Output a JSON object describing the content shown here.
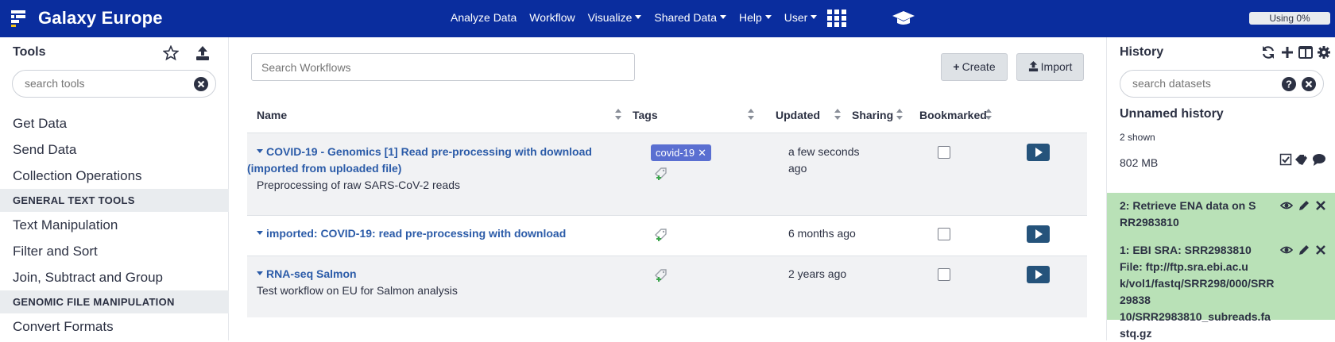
{
  "masthead": {
    "brand": "Galaxy Europe",
    "nav": [
      {
        "label": "Analyze Data",
        "dropdown": false
      },
      {
        "label": "Workflow",
        "dropdown": false
      },
      {
        "label": "Visualize",
        "dropdown": true
      },
      {
        "label": "Shared Data",
        "dropdown": true
      },
      {
        "label": "Help",
        "dropdown": true
      },
      {
        "label": "User",
        "dropdown": true
      }
    ],
    "quota": "Using 0%"
  },
  "tools": {
    "title": "Tools",
    "search_placeholder": "search tools",
    "items": [
      {
        "type": "item",
        "label": "Get Data"
      },
      {
        "type": "item",
        "label": "Send Data"
      },
      {
        "type": "item",
        "label": "Collection Operations"
      },
      {
        "type": "section",
        "label": "GENERAL TEXT TOOLS"
      },
      {
        "type": "item",
        "label": "Text Manipulation"
      },
      {
        "type": "item",
        "label": "Filter and Sort"
      },
      {
        "type": "item",
        "label": "Join, Subtract and Group"
      },
      {
        "type": "section",
        "label": "GENOMIC FILE MANIPULATION"
      },
      {
        "type": "item",
        "label": "Convert Formats"
      }
    ]
  },
  "workflows": {
    "search_placeholder": "Search Workflows",
    "create_label": "Create",
    "import_label": "Import",
    "columns": {
      "name": "Name",
      "tags": "Tags",
      "updated": "Updated",
      "sharing": "Sharing",
      "bookmarked": "Bookmarked"
    },
    "rows": [
      {
        "name_line1": "COVID-19 - Genomics [1] Read pre-processing with download",
        "name_line2": "(imported from uploaded file)",
        "description": "Preprocessing of raw SARS-CoV-2 reads",
        "tag": "covid-19",
        "updated_line1": "a few seconds",
        "updated_line2": "ago",
        "bookmarked": false
      },
      {
        "name_line1": "imported: COVID-19: read pre-processing with download",
        "name_line2": "",
        "description": "",
        "tag": "",
        "updated_line1": "6 months ago",
        "updated_line2": "",
        "bookmarked": false
      },
      {
        "name_line1": "RNA-seq Salmon",
        "name_line2": "",
        "description": "Test workflow on EU for Salmon analysis",
        "tag": "",
        "updated_line1": "2 years ago",
        "updated_line2": "",
        "bookmarked": false
      }
    ]
  },
  "history": {
    "title": "History",
    "search_placeholder": "search datasets",
    "name": "Unnamed history",
    "shown": "2 shown",
    "size": "802 MB",
    "datasets": [
      {
        "line1": "2: Retrieve ENA data on S",
        "line2": "RR2983810"
      },
      {
        "line1": "1: EBI SRA: SRR2983810",
        "line2": "File: ftp://ftp.sra.ebi.ac.u",
        "line3": "k/vol1/fastq/SRR298/000/SRR29838",
        "line4": "10/SRR2983810_subreads.fastq.gz"
      }
    ]
  },
  "colors": {
    "masthead": "#0a2d9e",
    "link": "#2b5ba8",
    "tag": "#5a6fd1",
    "run": "#25537b",
    "dataset_ok": "#b9e1b7"
  }
}
